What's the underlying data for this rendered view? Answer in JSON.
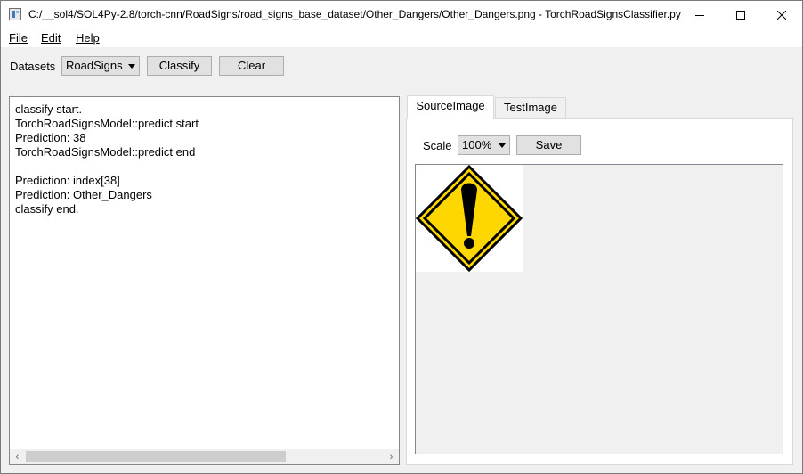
{
  "window": {
    "title": "C:/__sol4/SOL4Py-2.8/torch-cnn/RoadSigns/road_signs_base_dataset/Other_Dangers/Other_Dangers.png - TorchRoadSignsClassifier.py"
  },
  "menu": {
    "items": [
      {
        "label": "File"
      },
      {
        "label": "Edit"
      },
      {
        "label": "Help"
      }
    ]
  },
  "toolbar": {
    "datasets_label": "Datasets",
    "dataset_value": "RoadSigns",
    "classify_label": "Classify",
    "clear_label": "Clear"
  },
  "console": {
    "lines": [
      "classify start.",
      "TorchRoadSignsModel::predict start",
      "Prediction: 38",
      "TorchRoadSignsModel::predict end",
      "",
      "Prediction: index[38]",
      "Prediction: Other_Dangers",
      "classify end."
    ]
  },
  "tabs": [
    {
      "label": "SourceImage",
      "active": true
    },
    {
      "label": "TestImage",
      "active": false
    }
  ],
  "image_panel": {
    "scale_label": "Scale",
    "scale_value": "100%",
    "save_label": "Save"
  },
  "icons": {
    "minimize": "minimize-icon",
    "maximize": "maximize-icon",
    "close": "close-icon",
    "sign": "warning-exclamation-sign"
  },
  "colors": {
    "sign_yellow": "#ffd700",
    "sign_black": "#000000"
  }
}
